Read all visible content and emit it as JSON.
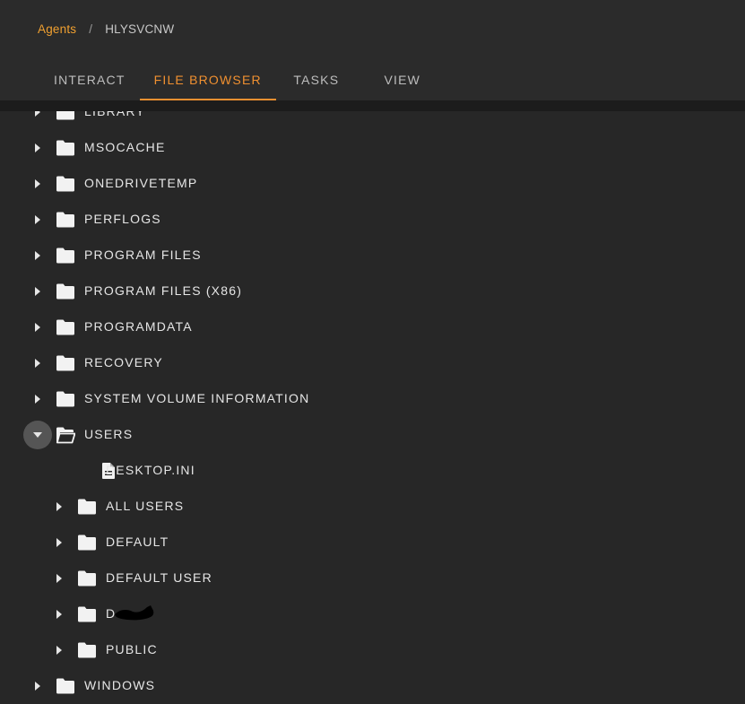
{
  "breadcrumb": {
    "root": "Agents",
    "separator": "/",
    "current": "HLYSVCNW"
  },
  "tabs": [
    {
      "label": "INTERACT",
      "active": false
    },
    {
      "label": "FILE BROWSER",
      "active": true
    },
    {
      "label": "TASKS",
      "active": false
    },
    {
      "label": "VIEW",
      "active": false
    }
  ],
  "tree": [
    {
      "label": "LIBRARY",
      "type": "folder",
      "level": 0,
      "expanded": false
    },
    {
      "label": "MSOCACHE",
      "type": "folder",
      "level": 0,
      "expanded": false
    },
    {
      "label": "ONEDRIVETEMP",
      "type": "folder",
      "level": 0,
      "expanded": false
    },
    {
      "label": "PERFLOGS",
      "type": "folder",
      "level": 0,
      "expanded": false
    },
    {
      "label": "PROGRAM FILES",
      "type": "folder",
      "level": 0,
      "expanded": false
    },
    {
      "label": "PROGRAM FILES (X86)",
      "type": "folder",
      "level": 0,
      "expanded": false
    },
    {
      "label": "PROGRAMDATA",
      "type": "folder",
      "level": 0,
      "expanded": false
    },
    {
      "label": "RECOVERY",
      "type": "folder",
      "level": 0,
      "expanded": false
    },
    {
      "label": "SYSTEM VOLUME INFORMATION",
      "type": "folder",
      "level": 0,
      "expanded": false
    },
    {
      "label": "USERS",
      "type": "folder",
      "level": 0,
      "expanded": true
    },
    {
      "label": "DESKTOP.INI",
      "type": "file",
      "level": 1,
      "expanded": false
    },
    {
      "label": "ALL USERS",
      "type": "folder",
      "level": 1,
      "expanded": false
    },
    {
      "label": "DEFAULT",
      "type": "folder",
      "level": 1,
      "expanded": false
    },
    {
      "label": "DEFAULT USER",
      "type": "folder",
      "level": 1,
      "expanded": false
    },
    {
      "label": "D",
      "type": "folder",
      "level": 1,
      "expanded": false,
      "redacted": true
    },
    {
      "label": "PUBLIC",
      "type": "folder",
      "level": 1,
      "expanded": false
    },
    {
      "label": "WINDOWS",
      "type": "folder",
      "level": 0,
      "expanded": false
    }
  ],
  "colors": {
    "accent": "#f09030",
    "background": "#272727",
    "header": "#2b2b2b",
    "text": "#e6e6e6"
  }
}
